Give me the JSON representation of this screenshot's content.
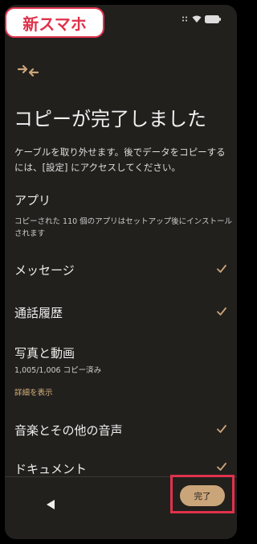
{
  "badge": {
    "label": "新スマホ"
  },
  "status_bar": {
    "icons": [
      "dots-icon",
      "wifi-icon",
      "battery-icon"
    ]
  },
  "header": {
    "icon": "transfer-arrows-icon",
    "title": "コピーが完了しました",
    "description": "ケーブルを取り外せます。後でデータをコピーするには、[設定] にアクセスしてください。"
  },
  "apps": {
    "title": "アプリ",
    "subtitle": "コピーされた 110 個のアプリはセットアップ後にインストールされます"
  },
  "items": [
    {
      "label": "メッセージ",
      "checked": true
    },
    {
      "label": "通話履歴",
      "checked": true
    },
    {
      "label": "写真と動画",
      "sub": "1,005/1,006 コピー済み",
      "link": "詳細を表示"
    },
    {
      "label": "音楽とその他の音声",
      "checked": true
    },
    {
      "label": "ドキュメント",
      "checked": true
    }
  ],
  "footer": {
    "done_label": "完了"
  },
  "colors": {
    "background": "#22201d",
    "accent": "#cba57a",
    "highlight": "#e0324b",
    "text": "#eeeeee"
  }
}
